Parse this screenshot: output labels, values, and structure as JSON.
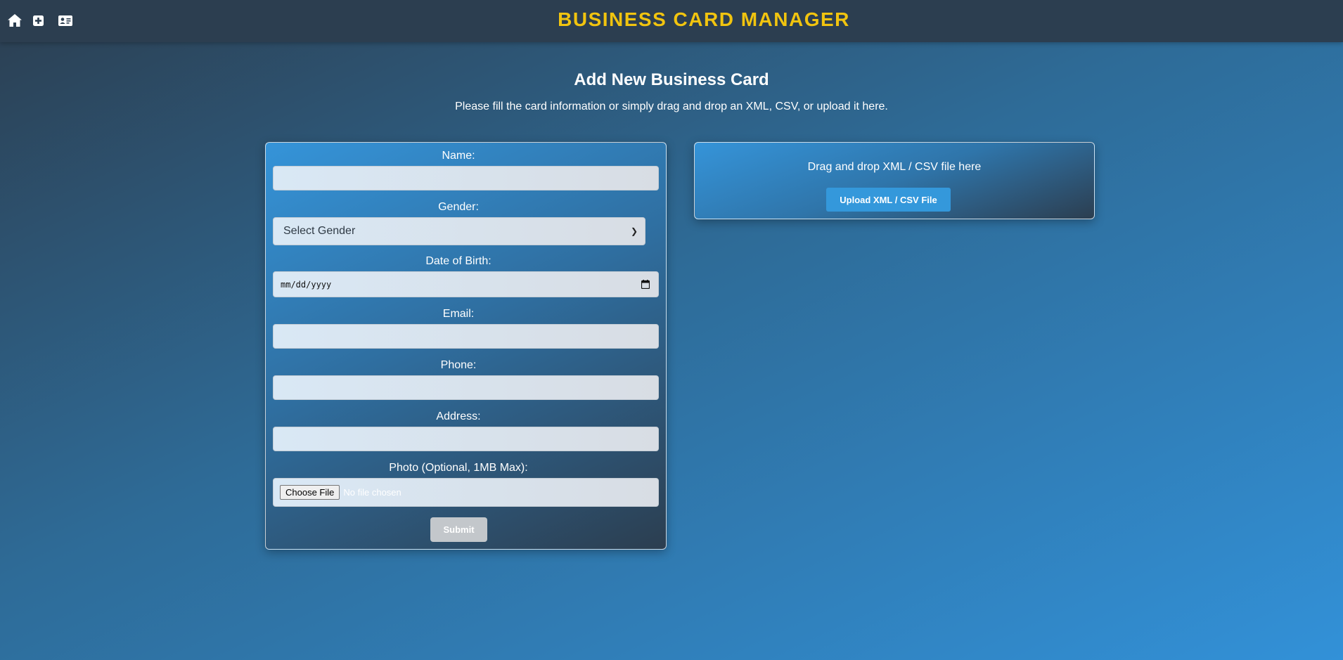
{
  "header": {
    "title": "BUSINESS CARD MANAGER",
    "nav": [
      {
        "icon": "home-icon"
      },
      {
        "icon": "plus-square-icon"
      },
      {
        "icon": "id-card-icon"
      }
    ]
  },
  "page": {
    "title": "Add New Business Card",
    "subtitle": "Please fill the card information or simply drag and drop an XML, CSV, or upload it here."
  },
  "form": {
    "name_label": "Name:",
    "name_value": "",
    "gender_label": "Gender:",
    "gender_selected": "Select Gender",
    "dob_label": "Date of Birth:",
    "dob_placeholder": "mm/dd/yyyy",
    "email_label": "Email:",
    "email_value": "",
    "phone_label": "Phone:",
    "phone_value": "",
    "address_label": "Address:",
    "address_value": "",
    "photo_label": "Photo (Optional, 1MB Max):",
    "choose_file_label": "Choose File",
    "no_file_text": "No file chosen",
    "submit_label": "Submit"
  },
  "upload": {
    "drop_text": "Drag and drop XML / CSV file here",
    "button_label": "Upload XML / CSV File"
  },
  "colors": {
    "brand": "#f1c40f",
    "topbar": "#2c3e50",
    "accent": "#3498db",
    "submit_disabled": "#c3c7cb"
  }
}
